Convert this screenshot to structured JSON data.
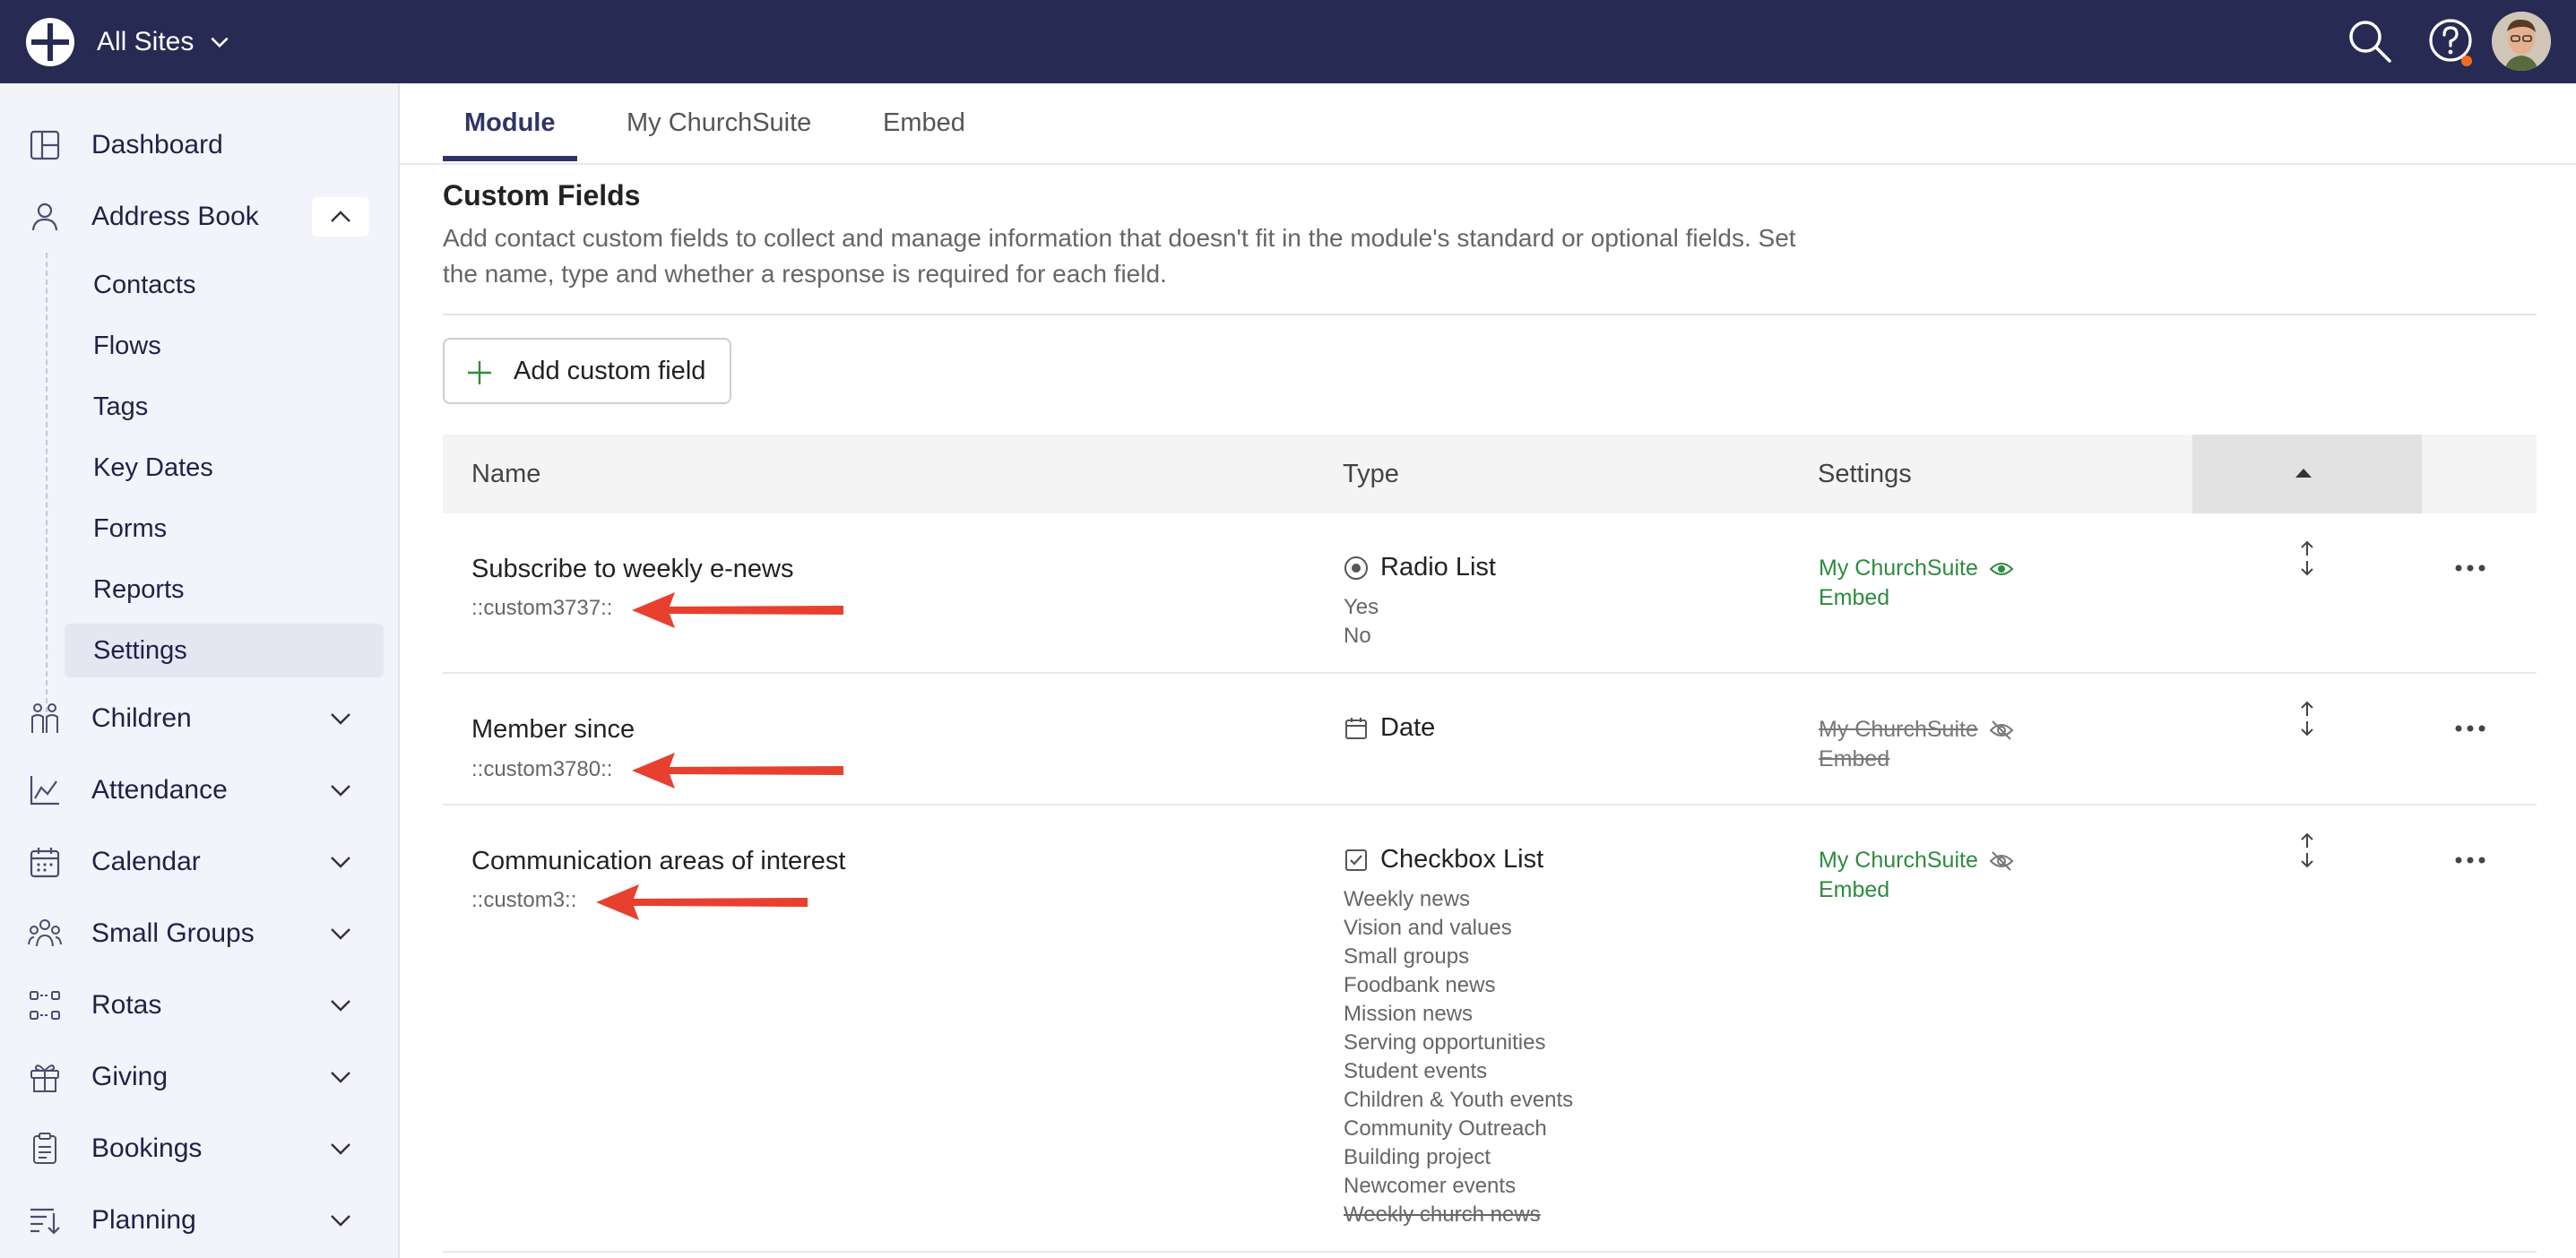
{
  "topbar": {
    "site_label": "All Sites"
  },
  "sidebar": {
    "items": [
      {
        "label": "Dashboard"
      },
      {
        "label": "Address Book"
      },
      {
        "label": "Children"
      },
      {
        "label": "Attendance"
      },
      {
        "label": "Calendar"
      },
      {
        "label": "Small Groups"
      },
      {
        "label": "Rotas"
      },
      {
        "label": "Giving"
      },
      {
        "label": "Bookings"
      },
      {
        "label": "Planning"
      }
    ],
    "address_book_sub": [
      {
        "label": "Contacts"
      },
      {
        "label": "Flows"
      },
      {
        "label": "Tags"
      },
      {
        "label": "Key Dates"
      },
      {
        "label": "Forms"
      },
      {
        "label": "Reports"
      },
      {
        "label": "Settings",
        "active": true
      }
    ]
  },
  "tabs": [
    {
      "label": "Module",
      "active": true
    },
    {
      "label": "My ChurchSuite"
    },
    {
      "label": "Embed"
    }
  ],
  "section": {
    "title": "Custom Fields",
    "description": "Add contact custom fields to collect and manage information that doesn't fit in the module's standard or optional fields. Set the name, type and whether a response is required for each field."
  },
  "add_button": {
    "label": "Add custom field"
  },
  "table": {
    "headers": {
      "name": "Name",
      "type": "Type",
      "settings": "Settings"
    },
    "rows": [
      {
        "name": "Subscribe to weekly e-news",
        "code": "::custom3737::",
        "type": "Radio List",
        "options": [
          "Yes",
          "No"
        ],
        "my_churchsuite": "My ChurchSuite",
        "embed": "Embed"
      },
      {
        "name": "Member since",
        "code": "::custom3780::",
        "type": "Date",
        "options": [],
        "my_churchsuite": "My ChurchSuite",
        "embed": "Embed"
      },
      {
        "name": "Communication areas of interest",
        "code": "::custom3::",
        "type": "Checkbox List",
        "options": [
          "Weekly news",
          "Vision and values",
          "Small groups",
          "Foodbank news",
          "Mission news",
          "Serving opportunities",
          "Student events",
          "Children & Youth events",
          "Community Outreach",
          "Building project",
          "Newcomer events",
          "Weekly church news"
        ],
        "my_churchsuite": "My ChurchSuite",
        "embed": "Embed"
      }
    ]
  },
  "colors": {
    "topbar": "#272a52",
    "sidebar_bg": "#f3f3fb",
    "accent": "#2f3466",
    "enabled_green": "#2e8b3e",
    "annotation_red": "#e8402f",
    "notification_dot": "#f26b21"
  }
}
